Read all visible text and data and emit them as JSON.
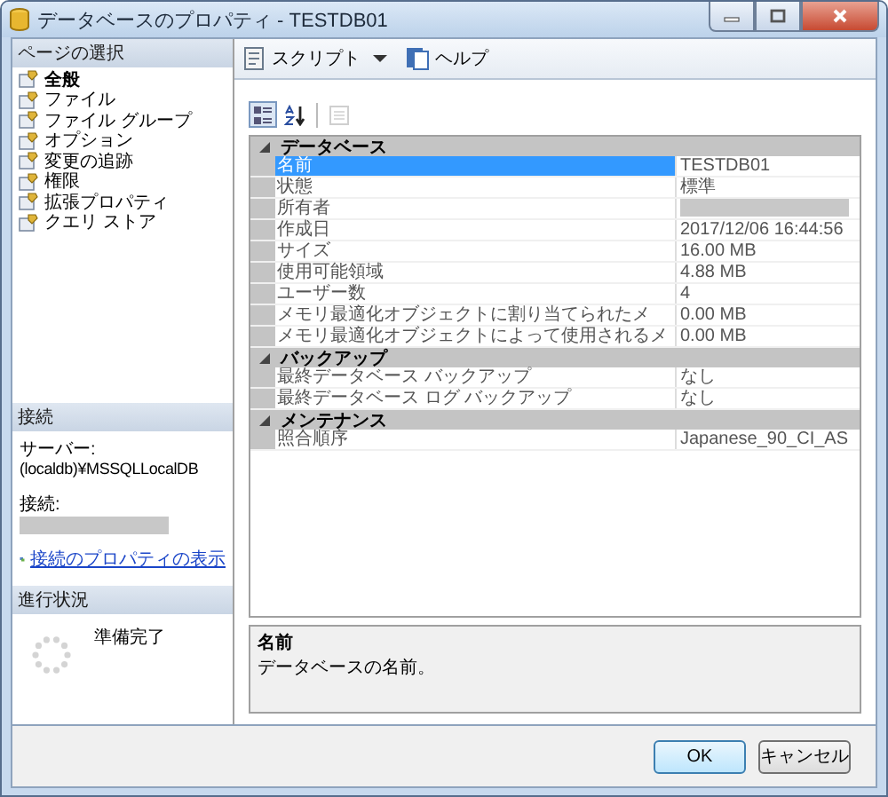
{
  "window": {
    "title": "データベースのプロパティ - TESTDB01"
  },
  "page_select": {
    "header": "ページの選択",
    "items": [
      {
        "label": "全般",
        "selected": true
      },
      {
        "label": "ファイル",
        "selected": false
      },
      {
        "label": "ファイル グループ",
        "selected": false
      },
      {
        "label": "オプション",
        "selected": false
      },
      {
        "label": "変更の追跡",
        "selected": false
      },
      {
        "label": "権限",
        "selected": false
      },
      {
        "label": "拡張プロパティ",
        "selected": false
      },
      {
        "label": "クエリ ストア",
        "selected": false
      }
    ]
  },
  "connection": {
    "header": "接続",
    "server_label": "サーバー:",
    "server": "(localdb)¥MSSQLLocalDB",
    "connection_label": "接続:",
    "connection_redacted": true,
    "link": "接続のプロパティの表示"
  },
  "progress": {
    "header": "進行状況",
    "status": "準備完了"
  },
  "toolbar": [
    {
      "kind": "script",
      "label": "スクリプト",
      "dropdown": true
    },
    {
      "kind": "help",
      "label": "ヘルプ",
      "dropdown": false
    }
  ],
  "grid_view": [
    {
      "kind": "categorized",
      "selected": true,
      "disabled": false
    },
    {
      "kind": "alphabetical",
      "selected": false,
      "disabled": false
    },
    {
      "kind": "pages",
      "selected": false,
      "disabled": true
    }
  ],
  "grid": [
    {
      "category": "データベース",
      "expanded": true,
      "rows": [
        {
          "name": "名前",
          "value": "TESTDB01",
          "selected": true,
          "redacted": false
        },
        {
          "name": "状態",
          "value": "標準",
          "selected": false,
          "redacted": false
        },
        {
          "name": "所有者",
          "selected": false,
          "redacted": true
        },
        {
          "name": "作成日",
          "value": "2017/12/06 16:44:56",
          "selected": false,
          "redacted": false
        },
        {
          "name": "サイズ",
          "value": "16.00 MB",
          "selected": false,
          "redacted": false
        },
        {
          "name": "使用可能領域",
          "value": "4.88 MB",
          "selected": false,
          "redacted": false
        },
        {
          "name": "ユーザー数",
          "value": "4",
          "selected": false,
          "redacted": false
        },
        {
          "name": "メモリ最適化オブジェクトに割り当てられたメ",
          "value": "0.00 MB",
          "selected": false,
          "redacted": false
        },
        {
          "name": "メモリ最適化オブジェクトによって使用されるメ",
          "value": "0.00 MB",
          "selected": false,
          "redacted": false
        }
      ]
    },
    {
      "category": "バックアップ",
      "expanded": true,
      "rows": [
        {
          "name": "最終データベース バックアップ",
          "value": "なし",
          "selected": false,
          "redacted": false
        },
        {
          "name": "最終データベース ログ バックアップ",
          "value": "なし",
          "selected": false,
          "redacted": false
        }
      ]
    },
    {
      "category": "メンテナンス",
      "expanded": true,
      "rows": [
        {
          "name": "照合順序",
          "value": "Japanese_90_CI_AS",
          "selected": false,
          "redacted": false
        }
      ]
    }
  ],
  "description": {
    "title": "名前",
    "text": "データベースの名前。"
  },
  "buttons": [
    {
      "label": "OK",
      "default": true
    },
    {
      "label": "キャンセル",
      "default": false
    }
  ]
}
